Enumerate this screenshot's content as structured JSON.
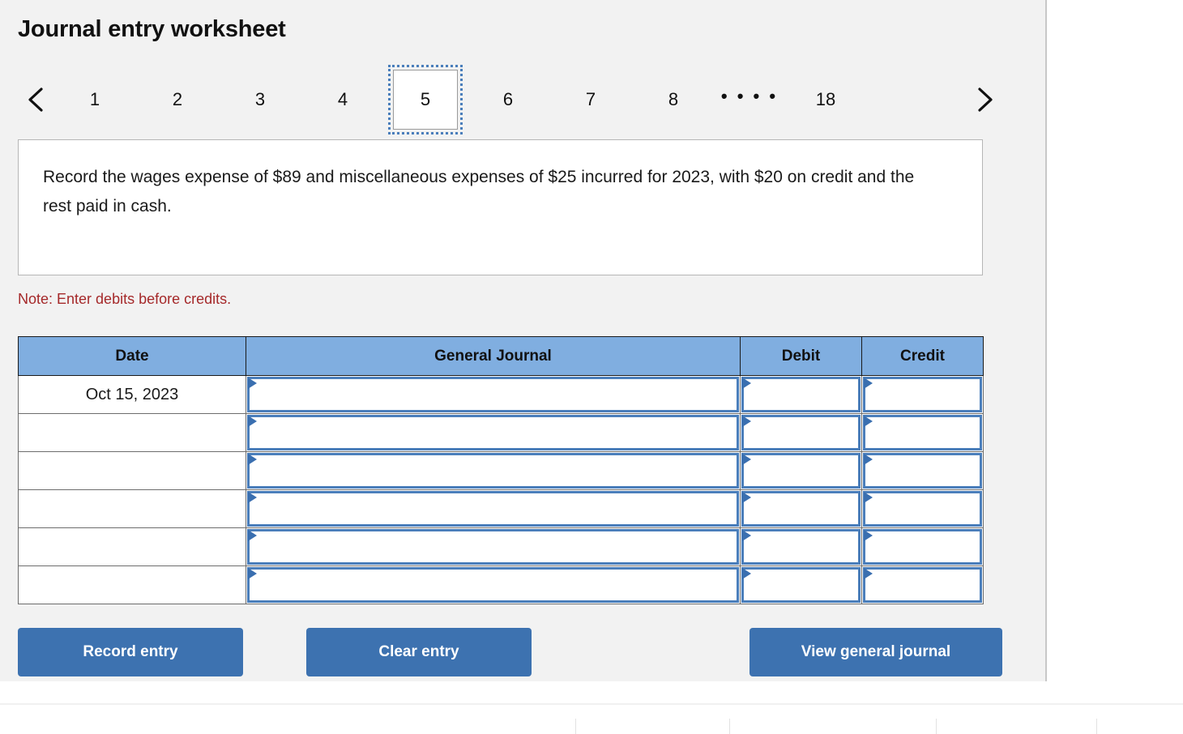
{
  "header": {
    "title": "Journal entry worksheet"
  },
  "pager": {
    "prev_icon": "chevron-left-icon",
    "next_icon": "chevron-right-icon",
    "pages": [
      "1",
      "2",
      "3",
      "4",
      "5",
      "6",
      "7",
      "8"
    ],
    "ellipsis": "• • • •",
    "last_page": "18",
    "selected": "5"
  },
  "question": {
    "text": "Record the wages expense of $89 and miscellaneous expenses of $25 incurred for 2023, with $20 on credit and the rest paid in cash."
  },
  "note": {
    "text": "Note: Enter debits before credits."
  },
  "table": {
    "columns": [
      "Date",
      "General Journal",
      "Debit",
      "Credit"
    ],
    "rows": [
      {
        "date": "Oct 15, 2023",
        "general_journal": "",
        "debit": "",
        "credit": ""
      },
      {
        "date": "",
        "general_journal": "",
        "debit": "",
        "credit": ""
      },
      {
        "date": "",
        "general_journal": "",
        "debit": "",
        "credit": ""
      },
      {
        "date": "",
        "general_journal": "",
        "debit": "",
        "credit": ""
      },
      {
        "date": "",
        "general_journal": "",
        "debit": "",
        "credit": ""
      },
      {
        "date": "",
        "general_journal": "",
        "debit": "",
        "credit": ""
      }
    ]
  },
  "buttons": {
    "record_entry": "Record entry",
    "clear_entry": "Clear entry",
    "view_general_journal": "View general journal"
  },
  "colors": {
    "panel_bg": "#f2f2f2",
    "accent_blue": "#3d72b0",
    "header_blue": "#80aee0",
    "field_border": "#4a7ebb",
    "note_red": "#a5292a"
  }
}
